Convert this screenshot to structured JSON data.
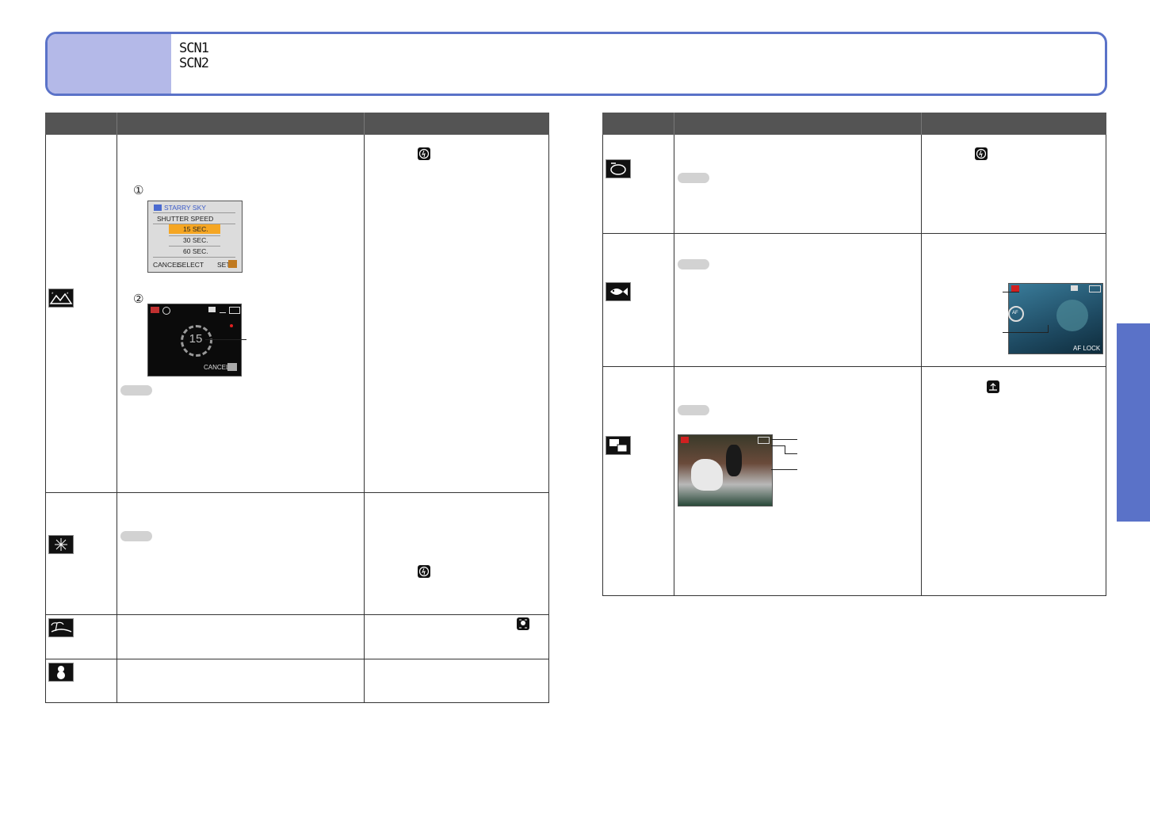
{
  "header": {
    "mode_line_1": "SCN1",
    "mode_line_2": "SCN2"
  },
  "menu_screen": {
    "title": "STARRY SKY",
    "row_label": "SHUTTER SPEED",
    "options": [
      "15 SEC.",
      "30 SEC.",
      "60 SEC."
    ],
    "selected": "15 SEC.",
    "footer_cancel": "CANCEL",
    "footer_select": "SELECT",
    "footer_set": "SET"
  },
  "countdown_screen": {
    "countdown": "15",
    "cancel": "CANCEL"
  },
  "step_markers": [
    "①",
    "②"
  ],
  "underwater_screen": {
    "af_label": "AF",
    "af_lock": "AF LOCK"
  },
  "colors": {
    "accent": "#5a72c8",
    "banner_fill": "#b4b9e8",
    "table_header": "#545454",
    "highlight": "#f5a623"
  },
  "icons": {
    "row1": "starry-sky-icon",
    "row2": "fireworks-icon",
    "row3": "beach-icon",
    "row4": "snow-icon",
    "row5": "aerial-photo-icon",
    "row6": "underwater-icon",
    "row7": "high-speed-burst-icon",
    "flash": "flash-off-icon"
  }
}
